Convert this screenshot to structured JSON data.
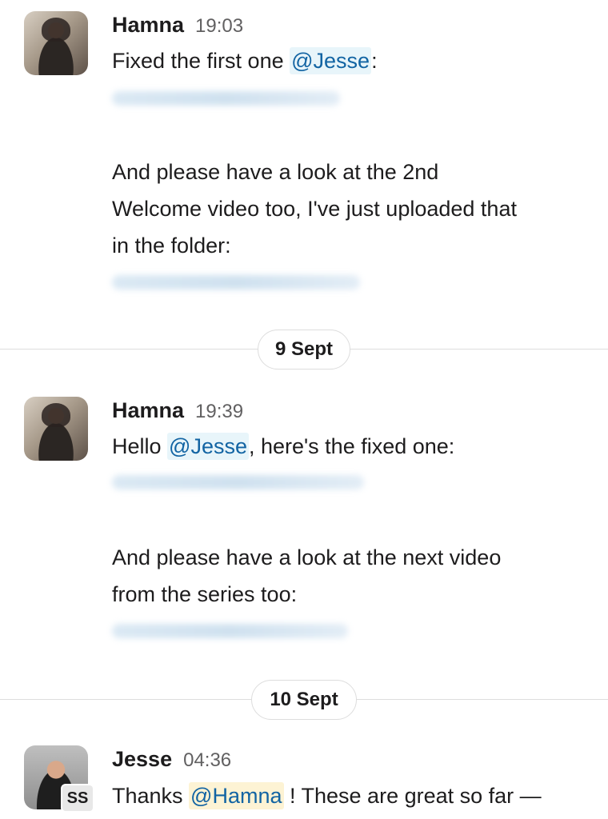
{
  "messages": [
    {
      "author": "Hamna",
      "time": "19:03",
      "line1_prefix": "Fixed the first one ",
      "line1_mention": "@Jesse",
      "line1_suffix": ":",
      "para2_line1": "And please have a look at the 2nd",
      "para2_line2": "Welcome video too, I've just uploaded that",
      "para2_line3": "in the folder:"
    },
    {
      "author": "Hamna",
      "time": "19:39",
      "line1_prefix": "Hello ",
      "line1_mention": "@Jesse",
      "line1_suffix": ", here's the fixed one:",
      "para2_line1": "And please have a look at the next video",
      "para2_line2": "from the series too:"
    },
    {
      "author": "Jesse",
      "time": "04:36",
      "badge": "SS",
      "line1_prefix": "Thanks ",
      "line1_mention": "@Hamna",
      "line1_suffix": " ! These are great so far —"
    }
  ],
  "dividers": [
    {
      "label": "9 Sept"
    },
    {
      "label": "10 Sept"
    }
  ],
  "colors": {
    "mention_text": "#1264a3",
    "mention_bg": "#e8f5fa",
    "self_mention_bg": "#fdf3d4",
    "divider": "#dddddd"
  }
}
